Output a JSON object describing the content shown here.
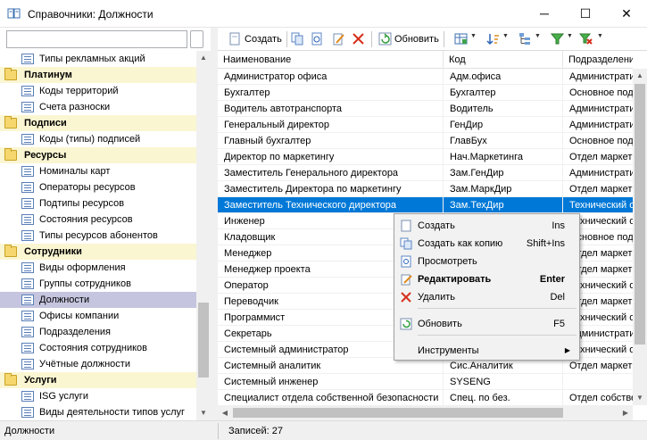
{
  "window": {
    "title": "Справочники: Должности",
    "minimize_glyph": "─",
    "maximize_glyph": "☐",
    "close_glyph": "✕"
  },
  "sidebar": {
    "search_value": "",
    "tree": [
      {
        "type": "item",
        "label": "Типы рекламных акций"
      },
      {
        "type": "group",
        "label": "Платинум"
      },
      {
        "type": "item",
        "label": "Коды территорий"
      },
      {
        "type": "item",
        "label": "Счета разноски"
      },
      {
        "type": "group",
        "label": "Подписи"
      },
      {
        "type": "item",
        "label": "Коды (типы) подписей"
      },
      {
        "type": "group",
        "label": "Ресурсы"
      },
      {
        "type": "item",
        "label": "Номиналы карт"
      },
      {
        "type": "item",
        "label": "Операторы ресурсов"
      },
      {
        "type": "item",
        "label": "Подтипы ресурсов"
      },
      {
        "type": "item",
        "label": "Состояния ресурсов"
      },
      {
        "type": "item",
        "label": "Типы ресурсов абонентов"
      },
      {
        "type": "group",
        "label": "Сотрудники"
      },
      {
        "type": "item",
        "label": "Виды оформления"
      },
      {
        "type": "item",
        "label": "Группы сотрудников"
      },
      {
        "type": "item",
        "label": "Должности",
        "selected": true
      },
      {
        "type": "item",
        "label": "Офисы компании"
      },
      {
        "type": "item",
        "label": "Подразделения"
      },
      {
        "type": "item",
        "label": "Состояния сотрудников"
      },
      {
        "type": "item",
        "label": "Учётные должности"
      },
      {
        "type": "group",
        "label": "Услуги"
      },
      {
        "type": "item",
        "label": "ISG услуги"
      },
      {
        "type": "item",
        "label": "Виды деятельности типов услуг"
      }
    ]
  },
  "toolbar": {
    "create_label": "Создать",
    "refresh_label": "Обновить"
  },
  "grid": {
    "columns": [
      "Наименование",
      "Код",
      "Подразделение"
    ],
    "rows": [
      [
        "Администратор офиса",
        "Адм.офиса",
        "Администрати"
      ],
      [
        "Бухгалтер",
        "Бухгалтер",
        "Основное под"
      ],
      [
        "Водитель автотранспорта",
        "Водитель",
        "Администрати"
      ],
      [
        "Генеральный директор",
        "ГенДир",
        "Администрати"
      ],
      [
        "Главный бухгалтер",
        "ГлавБух",
        "Основное под"
      ],
      [
        "Директор по маркетингу",
        "Нач.Маркетинга",
        "Отдел маркет"
      ],
      [
        "Заместитель Генерального директора",
        "Зам.ГенДир",
        "Администрати"
      ],
      [
        "Заместитель Директора по маркетингу",
        "Зам.МаркДир",
        "Отдел маркет"
      ],
      [
        "Заместитель Технического директора",
        "Зам.ТехДир",
        "Технический о"
      ],
      [
        "Инженер",
        "",
        "Технический о"
      ],
      [
        "Кладовщик",
        "",
        "Основное под"
      ],
      [
        "Менеджер",
        "",
        "Отдел маркет"
      ],
      [
        "Менеджер проекта",
        "",
        "Отдел маркет"
      ],
      [
        "Оператор",
        "",
        "Технический о"
      ],
      [
        "Переводчик",
        "",
        "Отдел маркет"
      ],
      [
        "Программист",
        "",
        "Технический о"
      ],
      [
        "Секретарь",
        "",
        "Администрати"
      ],
      [
        "Системный администратор",
        "",
        "Технический о"
      ],
      [
        "Системный аналитик",
        "Сис.Аналитик",
        "Отдел маркет"
      ],
      [
        "Системный инженер",
        "SYSENG",
        ""
      ],
      [
        "Специалист отдела собственной безопасности",
        "Спец. по без.",
        "Отдел собстве"
      ]
    ],
    "selected_row": 8
  },
  "context_menu": {
    "items": [
      {
        "label": "Создать",
        "shortcut": "Ins",
        "icon": "new-document-icon"
      },
      {
        "label": "Создать как копию",
        "shortcut": "Shift+Ins",
        "icon": "copy-document-icon"
      },
      {
        "label": "Просмотреть",
        "shortcut": "",
        "icon": "view-document-icon"
      },
      {
        "label": "Редактировать",
        "shortcut": "Enter",
        "icon": "edit-pencil-icon",
        "bold": true
      },
      {
        "label": "Удалить",
        "shortcut": "Del",
        "icon": "delete-x-icon"
      },
      {
        "label": "Обновить",
        "shortcut": "F5",
        "icon": "refresh-icon"
      },
      {
        "label": "Инструменты",
        "shortcut": "",
        "icon": "",
        "submenu": true
      }
    ]
  },
  "status": {
    "left": "Должности",
    "records": "Записей: 27"
  },
  "colors": {
    "selection": "#0078d7",
    "tree_group_bg": "#fbf6d2",
    "tree_selected_bg": "#c5c5df"
  }
}
